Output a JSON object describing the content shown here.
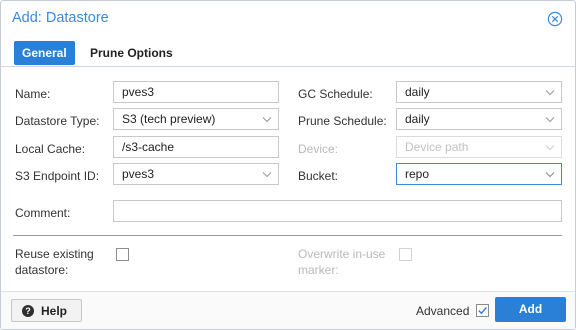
{
  "dialog": {
    "title": "Add: Datastore",
    "close_icon": "close-circle-icon"
  },
  "tabs": [
    {
      "label": "General",
      "active": true
    },
    {
      "label": "Prune Options",
      "active": false
    }
  ],
  "form": {
    "name": {
      "label": "Name:",
      "value": "pves3"
    },
    "datastore_type": {
      "label": "Datastore Type:",
      "value": "S3 (tech preview)"
    },
    "local_cache": {
      "label": "Local Cache:",
      "value": "/s3-cache"
    },
    "s3_endpoint_id": {
      "label": "S3 Endpoint ID:",
      "value": "pves3"
    },
    "gc_schedule": {
      "label": "GC Schedule:",
      "value": "daily"
    },
    "prune_schedule": {
      "label": "Prune Schedule:",
      "value": "daily"
    },
    "device": {
      "label": "Device:",
      "placeholder": "Device path",
      "disabled": true
    },
    "bucket": {
      "label": "Bucket:",
      "value": "repo"
    },
    "comment": {
      "label": "Comment:",
      "value": ""
    },
    "reuse_existing": {
      "label_line1": "Reuse existing",
      "label_line2": "datastore:",
      "checked": false
    },
    "overwrite_marker": {
      "label_line1": "Overwrite in-use",
      "label_line2": "marker:",
      "checked": false,
      "disabled": true
    }
  },
  "footer": {
    "help_label": "Help",
    "help_icon": "question-circle-icon",
    "advanced_label": "Advanced",
    "advanced_checked": true,
    "add_label": "Add"
  },
  "colors": {
    "accent": "#2a7fd6",
    "title": "#3a8ad8"
  }
}
